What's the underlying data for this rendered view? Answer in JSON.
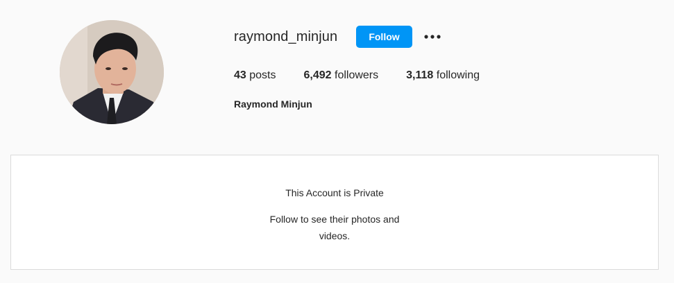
{
  "profile": {
    "username": "raymond_minjun",
    "full_name": "Raymond Minjun",
    "follow_label": "Follow",
    "more_icon": "more-horizontal-icon",
    "stats": {
      "posts_count": "43",
      "posts_label": "posts",
      "followers_count": "6,492",
      "followers_label": "followers",
      "following_count": "3,118",
      "following_label": "following"
    }
  },
  "private_notice": {
    "title": "This Account is Private",
    "subtitle": "Follow to see their photos and videos."
  },
  "colors": {
    "accent": "#0095f6",
    "background": "#fafafa",
    "card": "#ffffff",
    "border": "#dbdbdb",
    "text": "#262626"
  }
}
